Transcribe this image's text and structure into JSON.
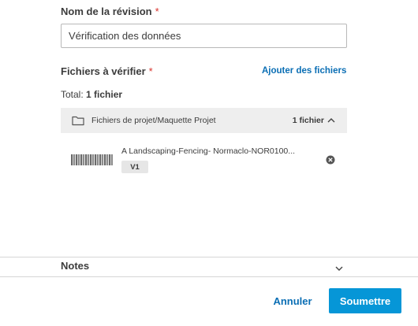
{
  "review_name": {
    "label": "Nom de la révision",
    "required_mark": "*",
    "value": "Vérification des données"
  },
  "files": {
    "label": "Fichiers à vérifier",
    "required_mark": "*",
    "add_link": "Ajouter des fichiers",
    "total_prefix": "Total:",
    "total_value": "1 fichier",
    "folder": {
      "path": "Fichiers de projet/Maquette Projet",
      "count": "1 fichier",
      "expanded": true
    },
    "items": [
      {
        "name": "A Landscaping-Fencing- Normaclo-NOR0100...",
        "version": "V1"
      }
    ]
  },
  "notes": {
    "label": "Notes",
    "expanded": false
  },
  "footer": {
    "cancel_label": "Annuler",
    "submit_label": "Soumettre"
  },
  "colors": {
    "accent": "#0696d7",
    "link": "#0a6eb4",
    "required": "#d8322b",
    "folder_bar": "#eeeeee"
  }
}
